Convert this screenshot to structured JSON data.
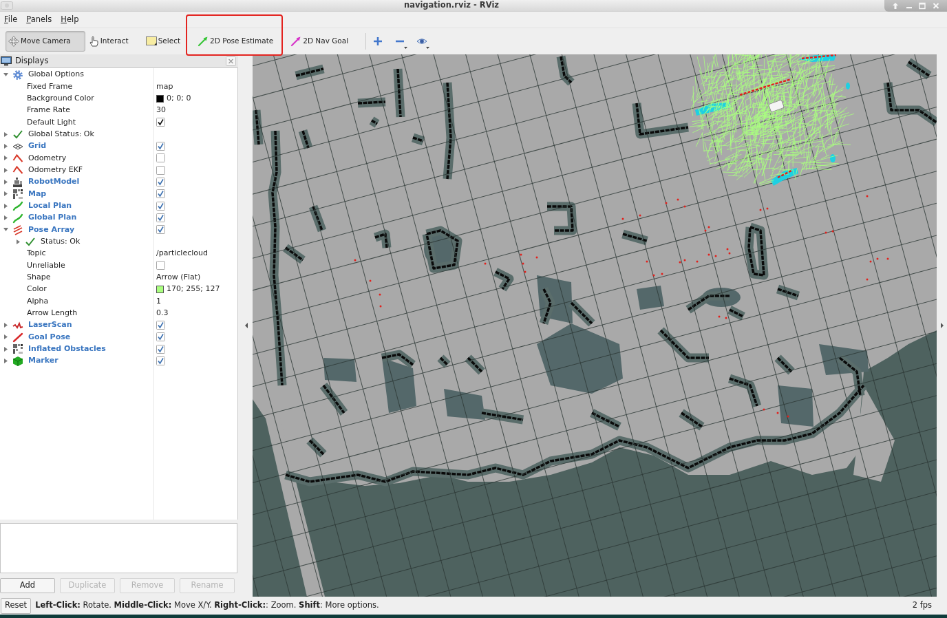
{
  "window": {
    "title": "navigation.rviz - RViz"
  },
  "menu": [
    "File",
    "Panels",
    "Help"
  ],
  "toolbar": {
    "tools": [
      {
        "label": "Move Camera",
        "selected": true,
        "highlighted": false
      },
      {
        "label": "Interact",
        "selected": false,
        "highlighted": false
      },
      {
        "label": "Select",
        "selected": false,
        "highlighted": false
      },
      {
        "label": "2D Pose Estimate",
        "selected": false,
        "highlighted": true
      },
      {
        "label": "2D Nav Goal",
        "selected": false,
        "highlighted": false
      }
    ],
    "view_tools": [
      {
        "menu": false
      },
      {
        "menu": true
      },
      {
        "menu": true
      }
    ]
  },
  "displays_panel": {
    "title": "Displays",
    "tree": [
      {
        "kind": "options",
        "label": "Global Options",
        "expanded": true,
        "children": [
          {
            "kind": "property",
            "label": "Fixed Frame",
            "value": "map"
          },
          {
            "kind": "property",
            "label": "Background Color",
            "color": "#000000",
            "value": "0; 0; 0"
          },
          {
            "kind": "property",
            "label": "Frame Rate",
            "value": "30"
          },
          {
            "kind": "property",
            "label": "Default Light",
            "checked": true
          }
        ]
      },
      {
        "kind": "status",
        "label": "Global Status: Ok",
        "expanded": false
      },
      {
        "kind": "grid",
        "label": "Grid",
        "expanded": false,
        "checked": true
      },
      {
        "kind": "odometry",
        "label": "Odometry",
        "expanded": false,
        "checked": false
      },
      {
        "kind": "odometry",
        "label": "Odometry EKF",
        "expanded": false,
        "checked": false
      },
      {
        "kind": "robotmodel",
        "label": "RobotModel",
        "expanded": false,
        "checked": true
      },
      {
        "kind": "map",
        "label": "Map",
        "expanded": false,
        "checked": true
      },
      {
        "kind": "path",
        "label": "Local Plan",
        "expanded": false,
        "checked": true
      },
      {
        "kind": "path",
        "label": "Global Plan",
        "expanded": false,
        "checked": true
      },
      {
        "kind": "posearray",
        "label": "Pose Array",
        "expanded": true,
        "checked": true,
        "children": [
          {
            "kind": "status",
            "label": "Status: Ok",
            "expanded": false
          },
          {
            "kind": "property",
            "label": "Topic",
            "value": "/particlecloud"
          },
          {
            "kind": "property",
            "label": "Unreliable",
            "checked": false
          },
          {
            "kind": "property",
            "label": "Shape",
            "value": "Arrow (Flat)"
          },
          {
            "kind": "property",
            "label": "Color",
            "color": "#aaff7f",
            "value": "170; 255; 127"
          },
          {
            "kind": "property",
            "label": "Alpha",
            "value": "1"
          },
          {
            "kind": "property",
            "label": "Arrow Length",
            "value": "0.3"
          }
        ]
      },
      {
        "kind": "laserscan",
        "label": "LaserScan",
        "expanded": false,
        "checked": true
      },
      {
        "kind": "pose",
        "label": "Goal Pose",
        "expanded": false,
        "checked": true
      },
      {
        "kind": "map",
        "label": "Inflated Obstacles",
        "expanded": false,
        "checked": true
      },
      {
        "kind": "marker",
        "label": "Marker",
        "expanded": false,
        "checked": true
      }
    ],
    "buttons": [
      {
        "label": "Add",
        "disabled": false
      },
      {
        "label": "Duplicate",
        "disabled": true
      },
      {
        "label": "Remove",
        "disabled": true
      },
      {
        "label": "Rename",
        "disabled": true
      }
    ]
  },
  "status_bar": {
    "reset": "Reset",
    "hint": "**Left-Click:** Rotate. **Middle-Click:** Move X/Y. **Right-Click:**: Zoom. **Shift**: More options.",
    "fps": "2 fps"
  }
}
